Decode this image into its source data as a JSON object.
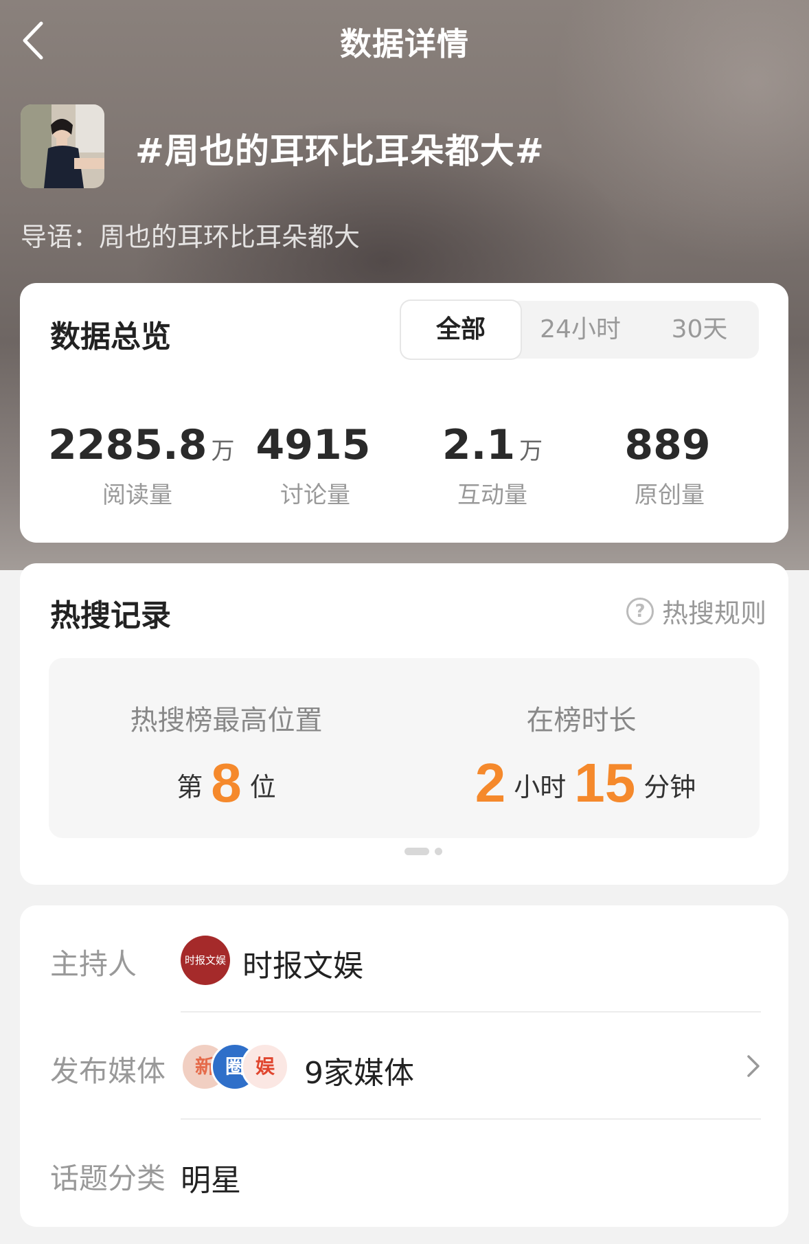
{
  "header": {
    "title": "数据详情"
  },
  "topic": {
    "title": "#周也的耳环比耳朵都大#",
    "intro": "导语：周也的耳环比耳朵都大"
  },
  "overview": {
    "title": "数据总览",
    "tabs": [
      {
        "label": "全部",
        "active": true
      },
      {
        "label": "24小时",
        "active": false
      },
      {
        "label": "30天",
        "active": false
      }
    ],
    "stats": [
      {
        "value": "2285.8",
        "unit": "万",
        "label": "阅读量"
      },
      {
        "value": "4915",
        "unit": "",
        "label": "讨论量"
      },
      {
        "value": "2.1",
        "unit": "万",
        "label": "互动量"
      },
      {
        "value": "889",
        "unit": "",
        "label": "原创量"
      }
    ]
  },
  "hot_search": {
    "title": "热搜记录",
    "rules_link": "热搜规则",
    "highest": {
      "label": "热搜榜最高位置",
      "prefix": "第",
      "rank": "8",
      "suffix": "位"
    },
    "duration": {
      "label": "在榜时长",
      "hours": "2",
      "hours_unit": "小时",
      "minutes": "15",
      "minutes_unit": "分钟"
    }
  },
  "info": {
    "host_label": "主持人",
    "host_name": "时报文娱",
    "host_avatar_text": "时报文娱",
    "media_label": "发布媒体",
    "media_value": "9家媒体",
    "media_avatars": [
      "新",
      "圈",
      "娱"
    ],
    "category_label": "话题分类",
    "category_value": "明星"
  },
  "colors": {
    "accent": "#f5892c"
  }
}
